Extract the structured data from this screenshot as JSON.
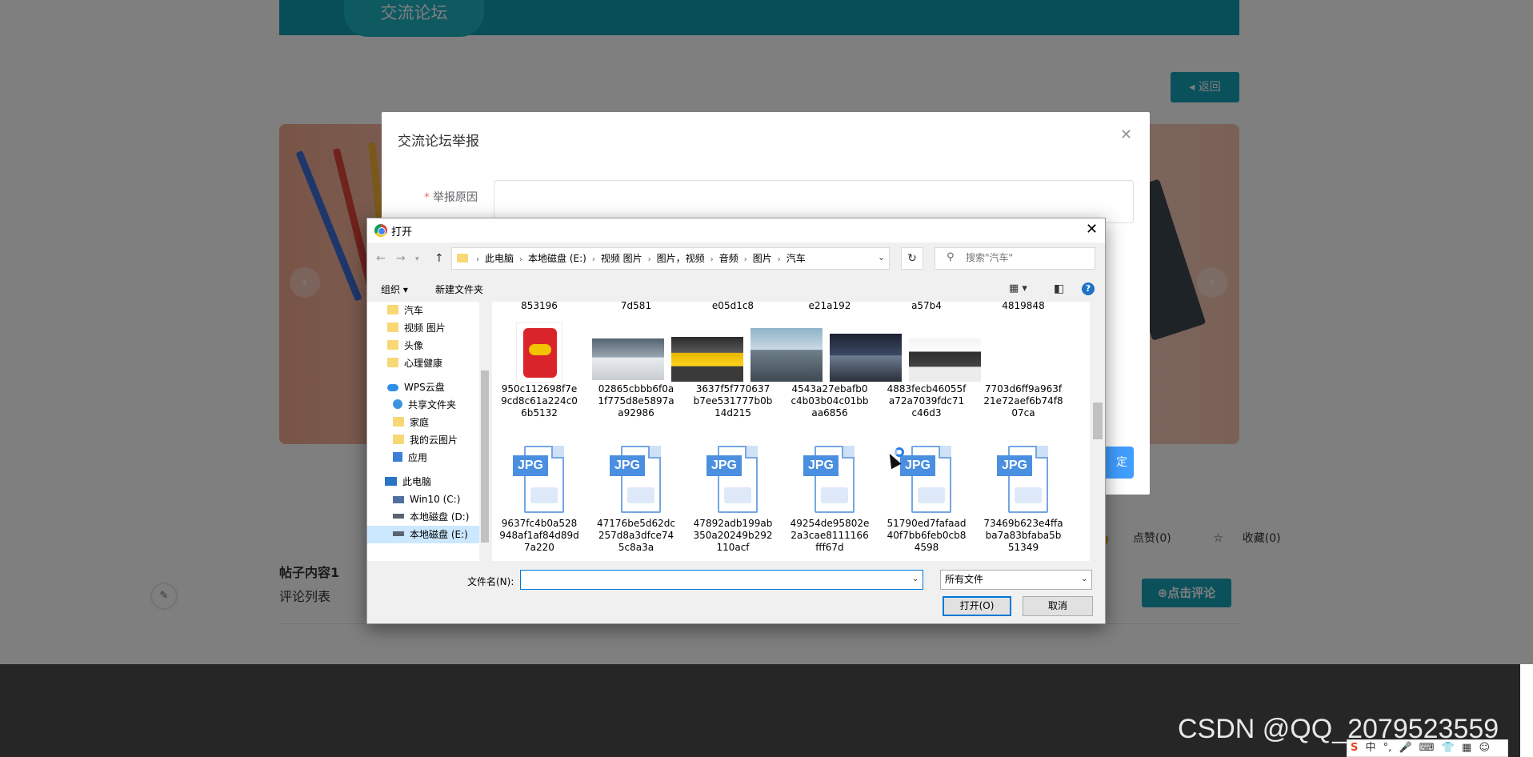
{
  "page": {
    "forum_tab": "交流论坛",
    "back_button": "返回",
    "back_icon": "caret-left-icon",
    "stats": {
      "like": "点赞(0)",
      "favorite": "收藏(0)"
    },
    "post_title": "帖子内容1",
    "comment_list_label": "评论列表",
    "comment_button": "点击评论",
    "accent_color": "#17a2b8"
  },
  "modal": {
    "title": "交流论坛举报",
    "reason_label": "举报原因",
    "required_mark": "*",
    "confirm_partial": "定"
  },
  "dialog": {
    "title": "打开",
    "breadcrumbs": [
      "此电脑",
      "本地磁盘 (E:)",
      "视频 图片",
      "图片，视频",
      "音频",
      "图片",
      "汽车"
    ],
    "search_placeholder": "搜索\"汽车\"",
    "toolbar": {
      "organize": "组织 ▾",
      "new_folder": "新建文件夹"
    },
    "nav_items": [
      {
        "label": "汽车",
        "icon": "folder"
      },
      {
        "label": "视频 图片",
        "icon": "folder"
      },
      {
        "label": "头像",
        "icon": "folder"
      },
      {
        "label": "心理健康",
        "icon": "folder"
      },
      {
        "label": "WPS云盘",
        "icon": "cloud"
      },
      {
        "label": "共享文件夹",
        "icon": "share"
      },
      {
        "label": "家庭",
        "icon": "folder"
      },
      {
        "label": "我的云图片",
        "icon": "folder"
      },
      {
        "label": "应用",
        "icon": "apps"
      },
      {
        "label": "此电脑",
        "icon": "pc"
      },
      {
        "label": "Win10 (C:)",
        "icon": "win"
      },
      {
        "label": "本地磁盘 (D:)",
        "icon": "drive"
      },
      {
        "label": "本地磁盘 (E:)",
        "icon": "drive"
      }
    ],
    "files_top_row": [
      "853196",
      "7d581",
      "e05d1c8",
      "e21a192",
      "a57b4",
      "4819848"
    ],
    "files_row2": [
      "950c112698f7e9cd8c61a224c06b5132",
      "02865cbbb6f0a1f775d8e5897aa92986",
      "3637f5f770637b7ee531777b0b14d215",
      "4543a27ebafb0c4b03b04c01bbaa6856",
      "4883fecb46055fa72a7039fdc71c46d3",
      "7703d6ff9a963f21e72aef6b74f807ca"
    ],
    "files_row3": [
      "9637fc4b0a528948af1af84d89d7a220",
      "47176be5d62dc257d8a3dfce745c8a3a",
      "47892adb199ab350a20249b292110acf",
      "49254de95802e2a3cae8111166fff67d",
      "51790ed7fafaad40f7bb6feb0cb84598",
      "73469b623e4ffaba7a83bfaba5b51349"
    ],
    "jpg_tag": "JPG",
    "filename_label": "文件名(N):",
    "filename_value": "",
    "filetype": "所有文件",
    "open_button": "打开(O)",
    "cancel_button": "取消"
  },
  "watermark": "CSDN @QQ_2079523559",
  "ime": [
    "中",
    "°,",
    "🎤",
    "⌨",
    "👕",
    "▦",
    "☺"
  ]
}
